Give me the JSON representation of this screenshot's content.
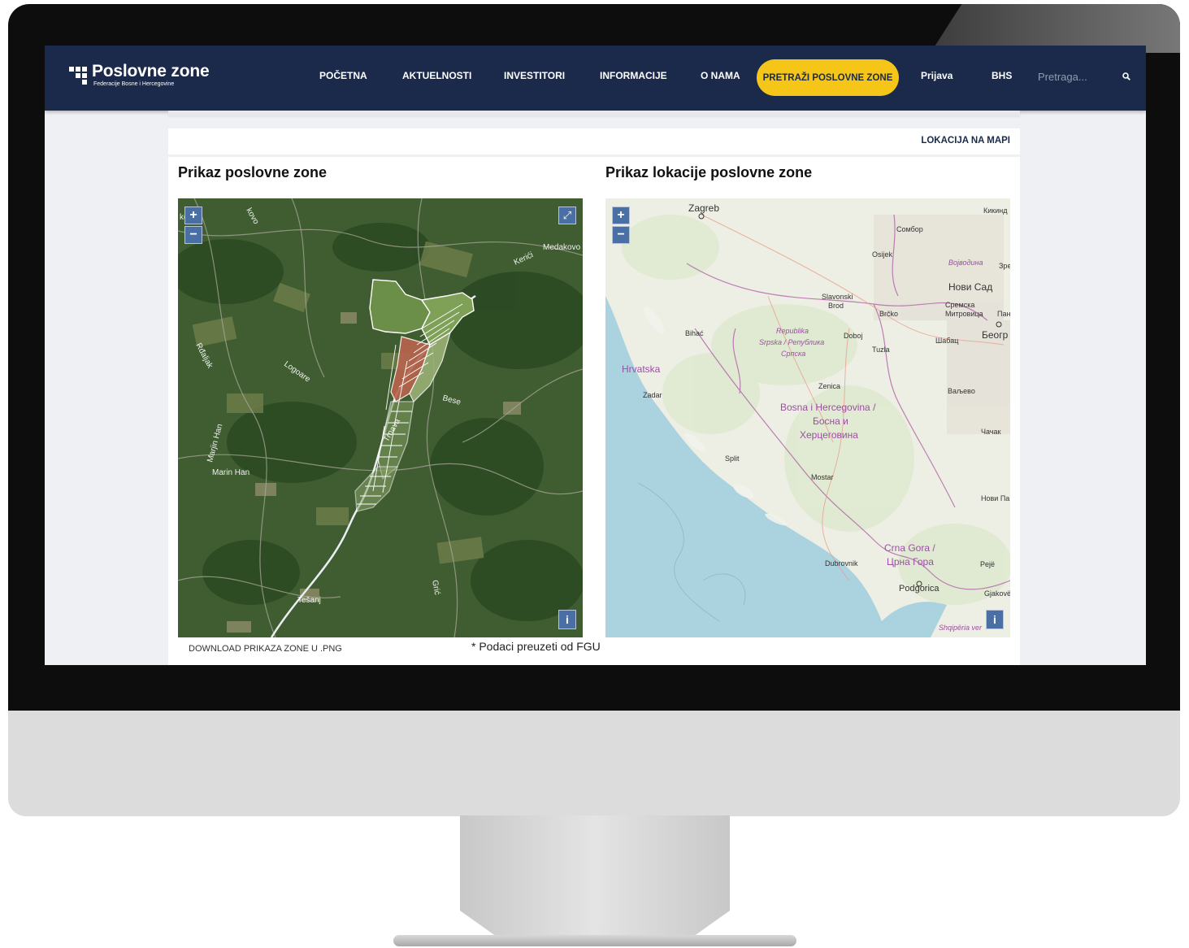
{
  "brand": {
    "title": "Poslovne zone",
    "subtitle": "Federacije Bosne i Hercegovine"
  },
  "nav": {
    "items": [
      "POČETNA",
      "AKTUELNOSTI",
      "INVESTITORI",
      "INFORMACIJE",
      "O NAMA"
    ],
    "cta": "PRETRAŽI POSLOVNE ZONE",
    "login": "Prijava",
    "language": "BHS",
    "search_placeholder": "Pretraga..."
  },
  "content": {
    "tab": "LOKACIJA NA MAPI",
    "left_heading": "Prikaz poslovne zone",
    "right_heading": "Prikaz lokacije poslovne zone",
    "download_label": "DOWNLOAD PRIKAZA ZONE U .PNG",
    "source_note": "* Podaci preuzeti od FGU"
  },
  "controls": {
    "zoom_in": "+",
    "zoom_out": "−",
    "fullscreen": "⤢",
    "info": "i"
  },
  "left_map": {
    "labels": [
      "kovo",
      "Medakovo",
      "Kerići",
      "Rđaljak",
      "Logoare",
      "Bese",
      "Marjin Han",
      "Marin Han",
      "Trnava",
      "Grić",
      "Tešanj",
      "ko"
    ]
  },
  "right_map": {
    "labels": [
      "Zagreb",
      "Кикинд",
      "Сомбор",
      "Osijek",
      "Војводина",
      "Зре",
      "Нови Сад",
      "Slavonski",
      "Brod",
      "Brčko",
      "Сремска",
      "Митровица",
      "Пан",
      "Bihać",
      "Republika",
      "Srpska / Република",
      "Српска",
      "Doboj",
      "Шабац",
      "Беогр",
      "Tuzla",
      "Hrvatska",
      "Zadar",
      "Zenica",
      "Ваљево",
      "Bosna i Hercegovina /",
      "Босна и",
      "Херцеговина",
      "Чачак",
      "Split",
      "Mostar",
      "Нови Па",
      "Crna Gora /",
      "Црна Гора",
      "Dubrovnik",
      "Pejë",
      "Podgorica",
      "Gjakovë",
      "Shqipëria ver"
    ]
  },
  "colors": {
    "navbar": "#1b2a4a",
    "cta": "#f5c518",
    "map_controls": "#4a6fa5",
    "page_bg": "#eef0f4"
  }
}
